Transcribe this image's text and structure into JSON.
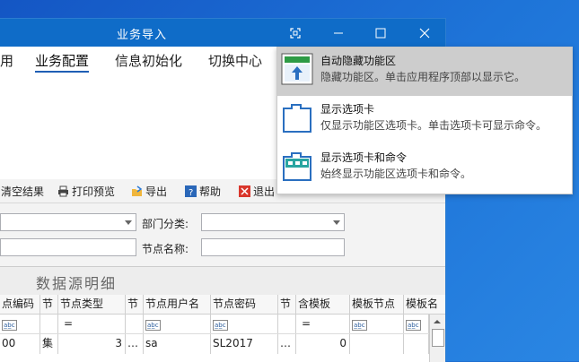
{
  "window": {
    "title": "业务导入"
  },
  "ribbon_tabs": [
    "用",
    "业务配置",
    "信息初始化",
    "切换中心"
  ],
  "toolbar": {
    "clear": "清空结果",
    "print_preview": "打印预览",
    "export": "导出",
    "help": "帮助",
    "exit": "退出"
  },
  "form": {
    "dept_label": "部门分类:",
    "node_name_label": "节点名称:"
  },
  "grid": {
    "title": "数据源明细",
    "columns": [
      "点编码",
      "节",
      "节点类型",
      "节",
      "节点用户名",
      "节点密码",
      "节",
      "含模板",
      "模板节点",
      "模板名"
    ],
    "filter_eq": "=",
    "filter_abc": "a̲b̲c",
    "row": {
      "code": "00",
      "ji": "集",
      "type": "3",
      "dots": "…",
      "user": "sa",
      "pwd": "SL2017",
      "dots2": "…",
      "tpl": "0"
    }
  },
  "ribbon_options": [
    {
      "title": "自动隐藏功能区",
      "desc": "隐藏功能区。单击应用程序顶部以显示它。",
      "icon": "auto-hide-ribbon-icon"
    },
    {
      "title": "显示选项卡",
      "desc": "仅显示功能区选项卡。单击选项卡可显示命令。",
      "icon": "show-tabs-icon"
    },
    {
      "title": "显示选项卡和命令",
      "desc": "始终显示功能区选项卡和命令。",
      "icon": "show-tabs-commands-icon"
    }
  ],
  "colors": {
    "titlebar": "#0f6cc8",
    "accent": "#1f5fb5",
    "desktop": "#1e74d8"
  }
}
